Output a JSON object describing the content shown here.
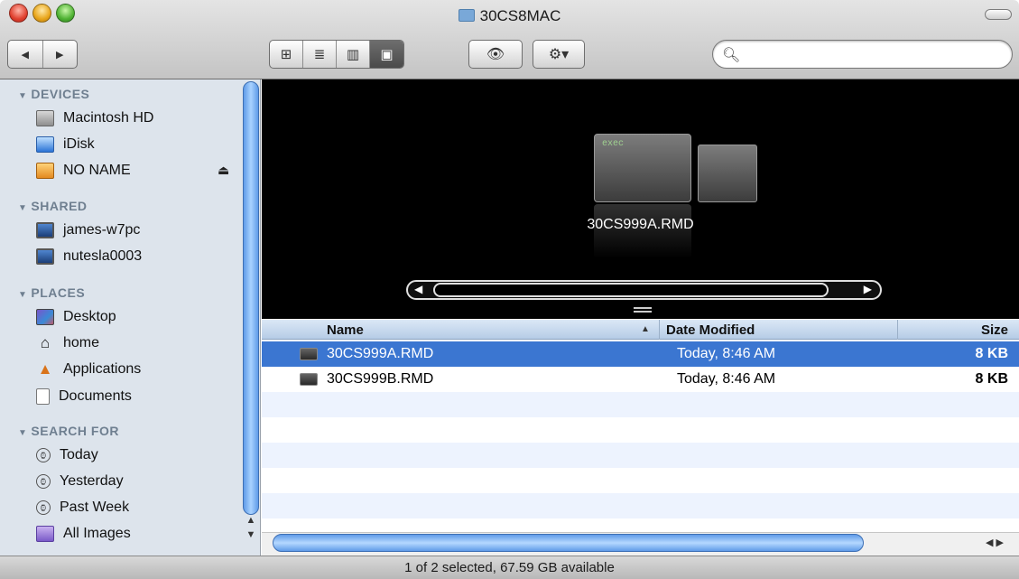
{
  "window": {
    "title": "30CS8MAC"
  },
  "toolbar": {
    "back_icon": "◀",
    "forward_icon": "▶",
    "view_icons": [
      "icon-view-icon",
      "list-view-icon",
      "column-view-icon",
      "cover-flow-view-icon"
    ],
    "view_glyphs": [
      "⊞",
      "≣",
      "▥",
      "▣"
    ],
    "quicklook_glyph": "👁",
    "action_glyph": "⚙▾",
    "search_placeholder": ""
  },
  "sidebar": {
    "sections": [
      {
        "label": "DEVICES",
        "items": [
          "Macintosh HD",
          "iDisk",
          "NO NAME"
        ]
      },
      {
        "label": "SHARED",
        "items": [
          "james-w7pc",
          "nutesla0003"
        ]
      },
      {
        "label": "PLACES",
        "items": [
          "Desktop",
          "home",
          "Applications",
          "Documents"
        ]
      },
      {
        "label": "SEARCH FOR",
        "items": [
          "Today",
          "Yesterday",
          "Past Week",
          "All Images"
        ]
      }
    ],
    "eject_glyph": "⏏"
  },
  "coverflow": {
    "selected_title": "30CS999A.RMD",
    "card_label": "exec"
  },
  "table": {
    "columns": [
      "Name",
      "Date Modified",
      "Size"
    ],
    "rows": [
      {
        "name": "30CS999A.RMD",
        "date": "Today, 8:46 AM",
        "size": "8 KB",
        "selected": true
      },
      {
        "name": "30CS999B.RMD",
        "date": "Today, 8:46 AM",
        "size": "8 KB",
        "selected": false
      }
    ]
  },
  "status": {
    "text": "1 of 2 selected, 67.59 GB available"
  },
  "colors": {
    "selection": "#3b76d1",
    "sidebar_bg": "#dde4ec",
    "section_header": "#6f7f90"
  }
}
